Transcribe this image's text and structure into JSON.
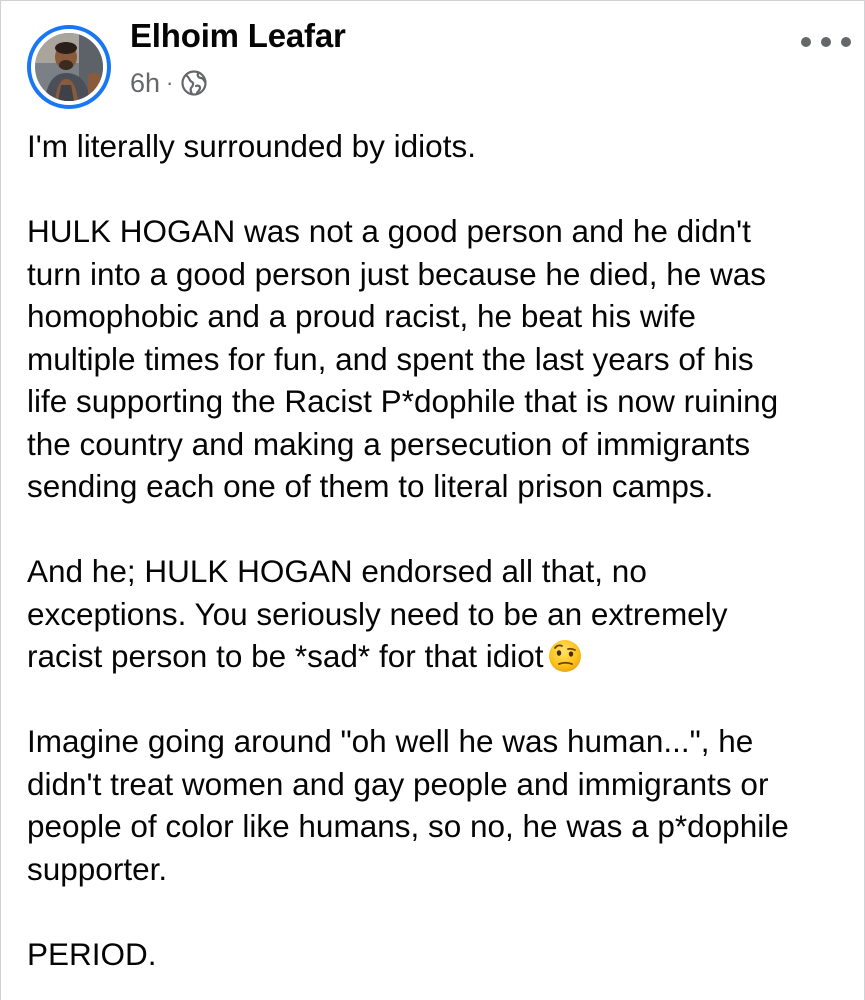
{
  "post": {
    "author": {
      "name": "Elhoim Leafar",
      "avatar_icon": "profile-photo"
    },
    "meta": {
      "time": "6h",
      "separator": "·",
      "audience_icon": "globe-icon"
    },
    "more_icon": "more-horizontal-icon",
    "paragraphs": [
      "I'm literally surrounded by idiots.",
      "HULK HOGAN was not a good person and he didn't\nturn into a good person just because he died, he was\nhomophobic and a proud racist, he beat his wife\nmultiple times for fun, and spent the last years of his\nlife supporting the Racist P*dophile that is now ruining\nthe country and making a persecution of immigrants\nsending each one of them to literal prison camps.",
      "And he; HULK HOGAN endorsed all that, no\nexceptions. You seriously need to be an extremely\nracist person to be  *sad* for that idiot",
      "Imagine going around \"oh well he was human...\", he\ndidn't treat women and gay people and immigrants or\npeople of color like humans, so no, he was a p*dophile\nsupporter.",
      "PERIOD."
    ],
    "emoji_icon": "face-with-raised-eyebrow-emoji",
    "colors": {
      "story_ring": "#1877f2",
      "name": "#050505",
      "meta": "#65676b",
      "text": "#050505"
    }
  }
}
